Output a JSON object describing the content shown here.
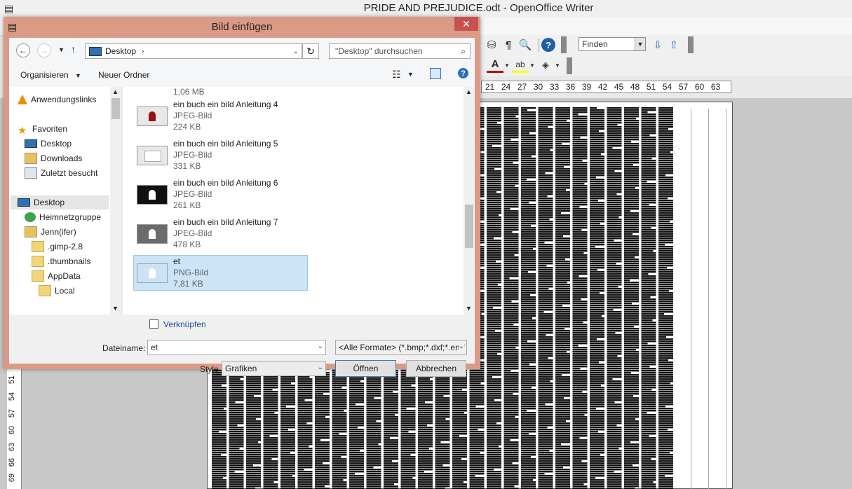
{
  "app": {
    "title": "PRIDE AND PREJUDICE.odt - OpenOffice Writer",
    "find_placeholder": "Finden",
    "ruler_ticks": [
      "21",
      "24",
      "27",
      "30",
      "33",
      "36",
      "39",
      "42",
      "45",
      "48",
      "51",
      "54",
      "57",
      "60",
      "63"
    ],
    "vruler_ticks": [
      "51",
      "54",
      "57",
      "60",
      "63",
      "66",
      "69"
    ]
  },
  "dialog": {
    "title": "Bild einfügen",
    "close": "✕",
    "address": "Desktop",
    "search_placeholder": "\"Desktop\" durchsuchen",
    "organize": "Organisieren",
    "new_folder": "Neuer Ordner",
    "nav_items": [
      {
        "label": "Anwendungslinks",
        "icon": "vlc-cone-icon"
      },
      {
        "label": "Favoriten",
        "icon": "star-icon"
      },
      {
        "label": "Desktop",
        "icon": "desktop-icon"
      },
      {
        "label": "Downloads",
        "icon": "downloads-icon"
      },
      {
        "label": "Zuletzt besucht",
        "icon": "recent-icon"
      },
      {
        "label": "Desktop",
        "icon": "desktop-icon"
      },
      {
        "label": "Heimnetzgruppe",
        "icon": "homegroup-icon"
      },
      {
        "label": "Jenn(ifer)",
        "icon": "user-folder-icon"
      },
      {
        "label": ".gimp-2.8",
        "icon": "folder-icon"
      },
      {
        "label": ".thumbnails",
        "icon": "folder-icon"
      },
      {
        "label": "AppData",
        "icon": "folder-icon"
      },
      {
        "label": "Local",
        "icon": "folder-icon"
      }
    ],
    "partial_size": "1,06 MB",
    "files": [
      {
        "name": "ein buch ein bild Anleitung 4",
        "type": "JPEG-Bild",
        "size": "224 KB"
      },
      {
        "name": "ein buch ein bild Anleitung 5",
        "type": "JPEG-Bild",
        "size": "331 KB"
      },
      {
        "name": "ein buch ein bild Anleitung 6",
        "type": "JPEG-Bild",
        "size": "261 KB"
      },
      {
        "name": "ein buch ein bild Anleitung 7",
        "type": "JPEG-Bild",
        "size": "478 KB"
      },
      {
        "name": "et",
        "type": "PNG-Bild",
        "size": "7,81 KB"
      }
    ],
    "link_label": "Verknüpfen",
    "filename_label": "Dateiname:",
    "filename_value": "et",
    "format_value": "<Alle Formate> (*.bmp;*.dxf;*.emf",
    "style_label": "Style",
    "style_value": "Grafiken",
    "open_button": "Öffnen",
    "cancel_button": "Abbrechen"
  }
}
